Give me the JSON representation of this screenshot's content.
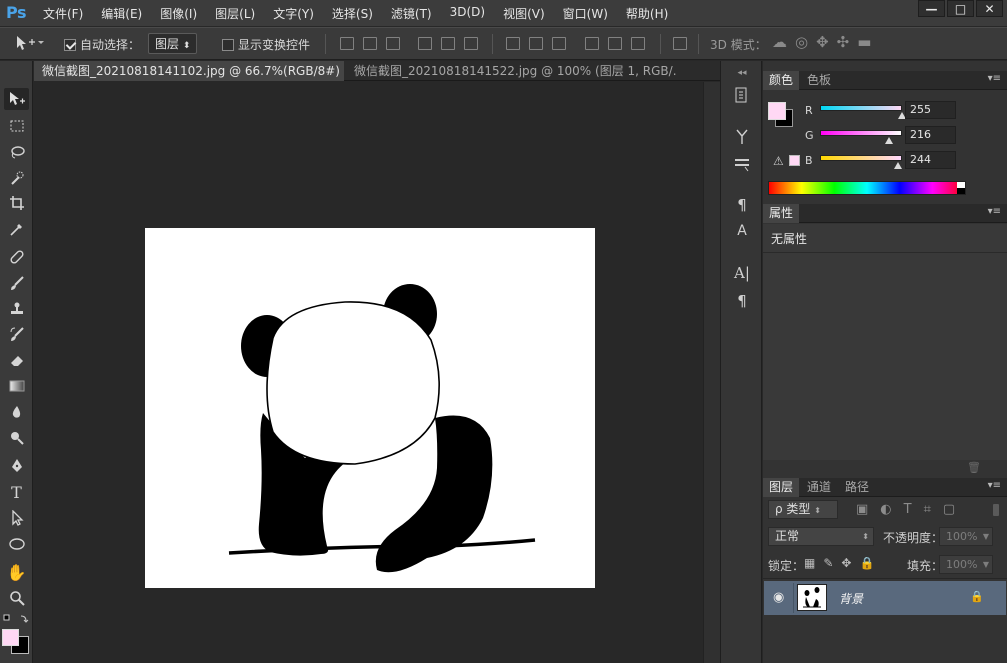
{
  "app": {
    "logo": "Ps",
    "menu": [
      "文件(F)",
      "编辑(E)",
      "图像(I)",
      "图层(L)",
      "文字(Y)",
      "选择(S)",
      "滤镜(T)",
      "3D(D)",
      "视图(V)",
      "窗口(W)",
      "帮助(H)"
    ],
    "window_controls": [
      "—",
      "□",
      "✕"
    ]
  },
  "options_bar": {
    "auto_select_label": "自动选择：",
    "auto_select_checked": true,
    "auto_select_value": "图层",
    "show_transform_label": "显示变换控件",
    "show_transform_checked": false,
    "mode_3d_label": "3D 模式："
  },
  "tabs": [
    {
      "label": "微信截图_20210818141102.jpg @ 66.7%(RGB/8#) *",
      "close": "×",
      "active": true
    },
    {
      "label": "微信截图_20210818141522.jpg @ 100% (图层 1, RGB/...",
      "close": "×",
      "active": false
    }
  ],
  "color_panel": {
    "tabs": [
      "颜色",
      "色板"
    ],
    "foreground_color": "#ffd8f4",
    "background_color": "#000000",
    "channels": [
      {
        "label": "R",
        "value": "255",
        "fraction": 1.0
      },
      {
        "label": "G",
        "value": "216",
        "fraction": 0.847
      },
      {
        "label": "B",
        "value": "244",
        "fraction": 0.957
      }
    ]
  },
  "properties_panel": {
    "tab": "属性",
    "content": "无属性"
  },
  "layers_panel": {
    "tabs": [
      "图层",
      "通道",
      "路径"
    ],
    "filter_label": "ρ 类型",
    "blend_mode": "正常",
    "opacity_label": "不透明度：",
    "opacity_value": "100%",
    "lock_label": "锁定：",
    "fill_label": "填充：",
    "fill_value": "100%",
    "layers": [
      {
        "name": "背景",
        "visible": true,
        "locked": true
      }
    ]
  },
  "toolbar": {
    "tools": [
      "move-tool",
      "marquee-tool",
      "lasso-tool",
      "quick-select-tool",
      "crop-tool",
      "eyedropper-tool",
      "healing-brush-tool",
      "brush-tool",
      "stamp-tool",
      "history-brush-tool",
      "eraser-tool",
      "gradient-tool",
      "blur-tool",
      "dodge-tool",
      "pen-tool",
      "type-tool",
      "path-select-tool",
      "shape-tool",
      "hand-tool",
      "zoom-tool"
    ]
  }
}
